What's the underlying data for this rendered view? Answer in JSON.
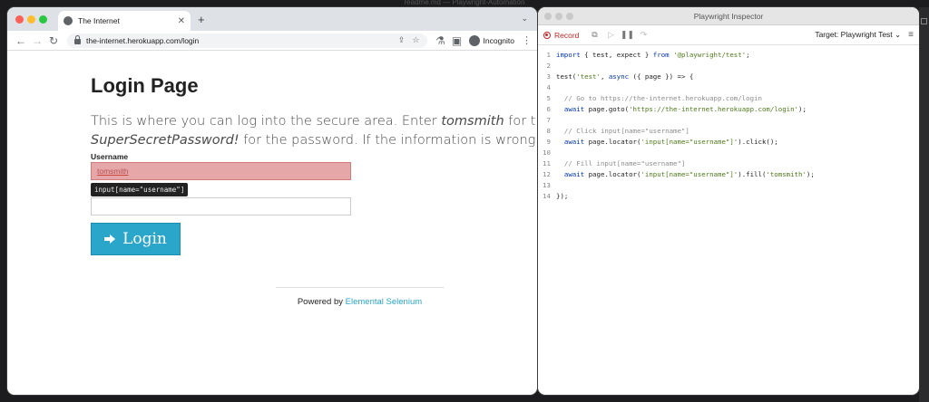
{
  "desktop": {
    "window_title": "readme.md — Playwright-Automation"
  },
  "browser": {
    "tab_title": "The Internet",
    "url": "the-internet.herokuapp.com/login",
    "incognito_label": "Incognito"
  },
  "page": {
    "title": "Login Page",
    "intro_1": "This is where you can log into the secure area. Enter ",
    "intro_user": "tomsmith",
    "intro_2": " for the username and",
    "intro_pass": "SuperSecretPassword!",
    "intro_3": " for the password. If the information is wrong you should see e",
    "username_label": "Username",
    "username_value": "tomsmith",
    "tooltip": "input[name=\"username\"]",
    "login_label": "Login",
    "footer_prefix": "Powered by ",
    "footer_link": "Elemental Selenium"
  },
  "inspector": {
    "title": "Playwright Inspector",
    "record_label": "Record",
    "target_label": "Target: Playwright Test",
    "code_lines": [
      {
        "n": "1",
        "text": "import { test, expect } from '@playwright/test';"
      },
      {
        "n": "2",
        "text": ""
      },
      {
        "n": "3",
        "text": "test('test', async ({ page }) => {"
      },
      {
        "n": "4",
        "text": ""
      },
      {
        "n": "5",
        "text": "  // Go to https://the-internet.herokuapp.com/login"
      },
      {
        "n": "6",
        "text": "  await page.goto('https://the-internet.herokuapp.com/login');"
      },
      {
        "n": "7",
        "text": ""
      },
      {
        "n": "8",
        "text": "  // Click input[name=\"username\"]"
      },
      {
        "n": "9",
        "text": "  await page.locator('input[name=\"username\"]').click();"
      },
      {
        "n": "10",
        "text": ""
      },
      {
        "n": "11",
        "text": "  // Fill input[name=\"username\"]"
      },
      {
        "n": "12",
        "text": "  await page.locator('input[name=\"username\"]').fill('tomsmith');"
      },
      {
        "n": "13",
        "text": ""
      },
      {
        "n": "14",
        "text": "});"
      }
    ]
  }
}
